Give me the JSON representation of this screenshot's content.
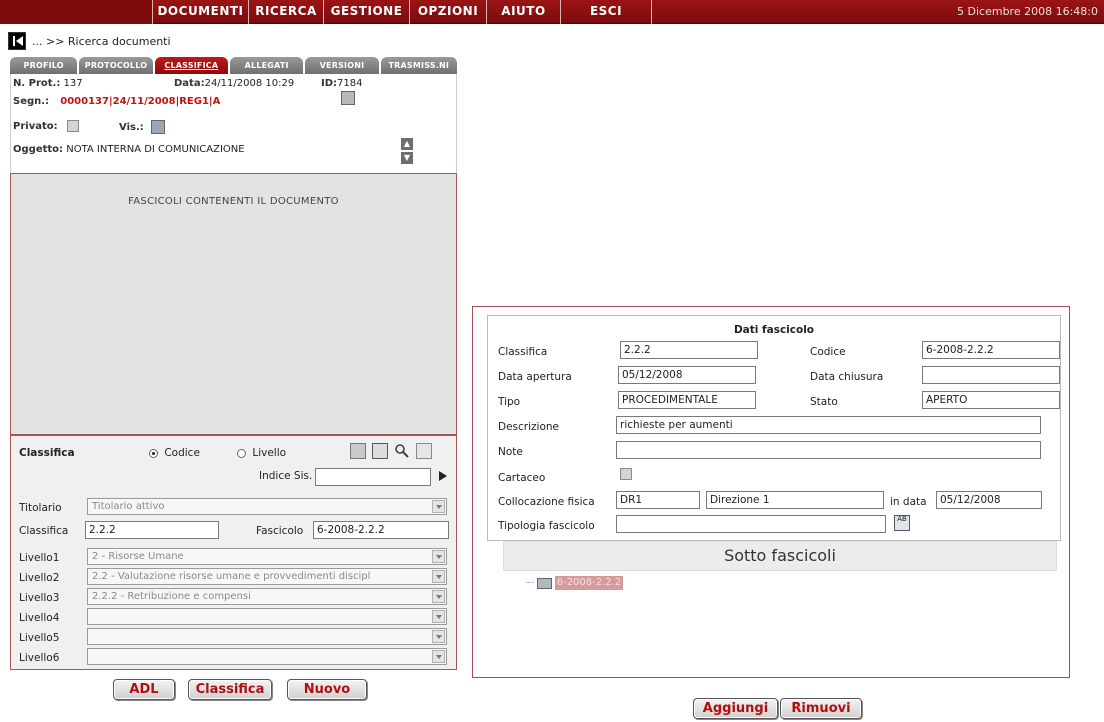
{
  "menu": {
    "items": [
      "DOCUMENTI",
      "RICERCA",
      "GESTIONE",
      "OPZIONI",
      "AIUTO",
      "ESCI"
    ],
    "datetime": "5 Dicembre 2008 16:48:0"
  },
  "breadcrumb": "... >> Ricerca documenti",
  "tabs": [
    "PROFILO",
    "PROTOCOLLO",
    "CLASSIFICA",
    "ALLEGATI",
    "VERSIONI",
    "TRASMISS.NI"
  ],
  "doc": {
    "nprot_label": "N. Prot.:",
    "nprot_value": "137",
    "data_label": "Data:",
    "data_value": "24/11/2008 10:29",
    "id_label": "ID:",
    "id_value": "7184",
    "segn_label": "Segn.:",
    "segn_value": "0000137|24/11/2008|REG1|A",
    "privato_label": "Privato:",
    "vis_label": "Vis.:",
    "oggetto_label": "Oggetto:",
    "oggetto_value": "NOTA INTERNA DI COMUNICAZIONE"
  },
  "fascicoli_title": "FASCICOLI CONTENENTI IL DOCUMENTO",
  "classifica_panel": {
    "title": "Classifica",
    "radio_codice": "Codice",
    "radio_livello": "Livello",
    "indice_label": "Indice Sis.",
    "indice_value": "",
    "titolario_label": "Titolario",
    "titolario_value": "Titolario attivo",
    "classifica_label": "Classifica",
    "classifica_value": "2.2.2",
    "fascicolo_label": "Fascicolo",
    "fascicolo_value": "6-2008-2.2.2",
    "livelli": [
      {
        "label": "Livello1",
        "value": "2 - Risorse Umane"
      },
      {
        "label": "Livello2",
        "value": "2.2 - Valutazione risorse umane e provvedimenti discipl"
      },
      {
        "label": "Livello3",
        "value": "2.2.2 - Retribuzione e compensi"
      },
      {
        "label": "Livello4",
        "value": ""
      },
      {
        "label": "Livello5",
        "value": ""
      },
      {
        "label": "Livello6",
        "value": ""
      }
    ]
  },
  "left_buttons": {
    "adl": "ADL",
    "classifica": "Classifica",
    "nuovo": "Nuovo"
  },
  "dati": {
    "title": "Dati fascicolo",
    "classifica_label": "Classifica",
    "classifica_value": "2.2.2",
    "codice_label": "Codice",
    "codice_value": "6-2008-2.2.2",
    "apertura_label": "Data apertura",
    "apertura_value": "05/12/2008",
    "chiusura_label": "Data chiusura",
    "chiusura_value": "",
    "tipo_label": "Tipo",
    "tipo_value": "PROCEDIMENTALE",
    "stato_label": "Stato",
    "stato_value": "APERTO",
    "descrizione_label": "Descrizione",
    "descrizione_value": "richieste per aumenti",
    "note_label": "Note",
    "note_value": "",
    "cartaceo_label": "Cartaceo",
    "collocazione_label": "Collocazione fisica",
    "collocazione_code": "DR1",
    "collocazione_desc": "Direzione 1",
    "in_data_label": "in data",
    "in_data_value": "05/12/2008",
    "tipologia_label": "Tipologia fascicolo",
    "tipologia_value": ""
  },
  "sotto": {
    "title": "Sotto fascicoli",
    "node": "6-2008-2.2.2"
  },
  "right_buttons": {
    "aggiungi": "Aggiungi",
    "rimuovi": "Rimuovi"
  },
  "colors": {
    "brand_red": "#8f0a0a",
    "accent_red": "#c41212"
  }
}
